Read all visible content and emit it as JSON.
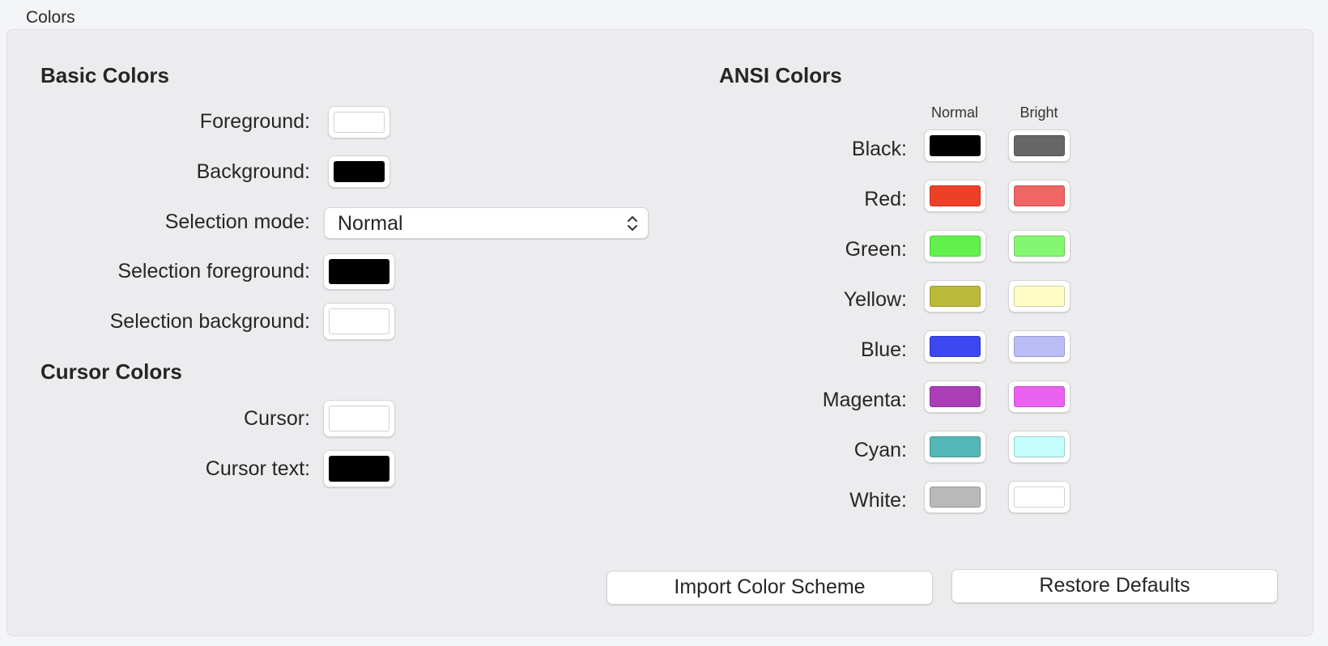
{
  "section_title": "Colors",
  "basic": {
    "heading": "Basic Colors",
    "foreground_label": "Foreground:",
    "foreground_color": "#ffffff",
    "background_label": "Background:",
    "background_color": "#000000",
    "selection_mode_label": "Selection mode:",
    "selection_mode_value": "Normal",
    "selection_fg_label": "Selection foreground:",
    "selection_fg_color": "#000000",
    "selection_bg_label": "Selection background:",
    "selection_bg_color": "#ffffff"
  },
  "cursor": {
    "heading": "Cursor Colors",
    "cursor_label": "Cursor:",
    "cursor_color": "#ffffff",
    "cursor_text_label": "Cursor text:",
    "cursor_text_color": "#000000"
  },
  "ansi": {
    "heading": "ANSI Colors",
    "normal_header": "Normal",
    "bright_header": "Bright",
    "rows": [
      {
        "label": "Black:",
        "normal": "#000000",
        "bright": "#666666"
      },
      {
        "label": "Red:",
        "normal": "#ee4026",
        "bright": "#ef6663"
      },
      {
        "label": "Green:",
        "normal": "#62f14c",
        "bright": "#85f671"
      },
      {
        "label": "Yellow:",
        "normal": "#bab93a",
        "bright": "#fefdc6"
      },
      {
        "label": "Blue:",
        "normal": "#3c46f1",
        "bright": "#bcbcf6"
      },
      {
        "label": "Magenta:",
        "normal": "#ab3db7",
        "bright": "#ec62f0"
      },
      {
        "label": "Cyan:",
        "normal": "#54b7b8",
        "bright": "#c3fdfd"
      },
      {
        "label": "White:",
        "normal": "#b9b9b9",
        "bright": "#ffffff"
      }
    ]
  },
  "buttons": {
    "import_label": "Import Color Scheme",
    "restore_label": "Restore Defaults"
  }
}
